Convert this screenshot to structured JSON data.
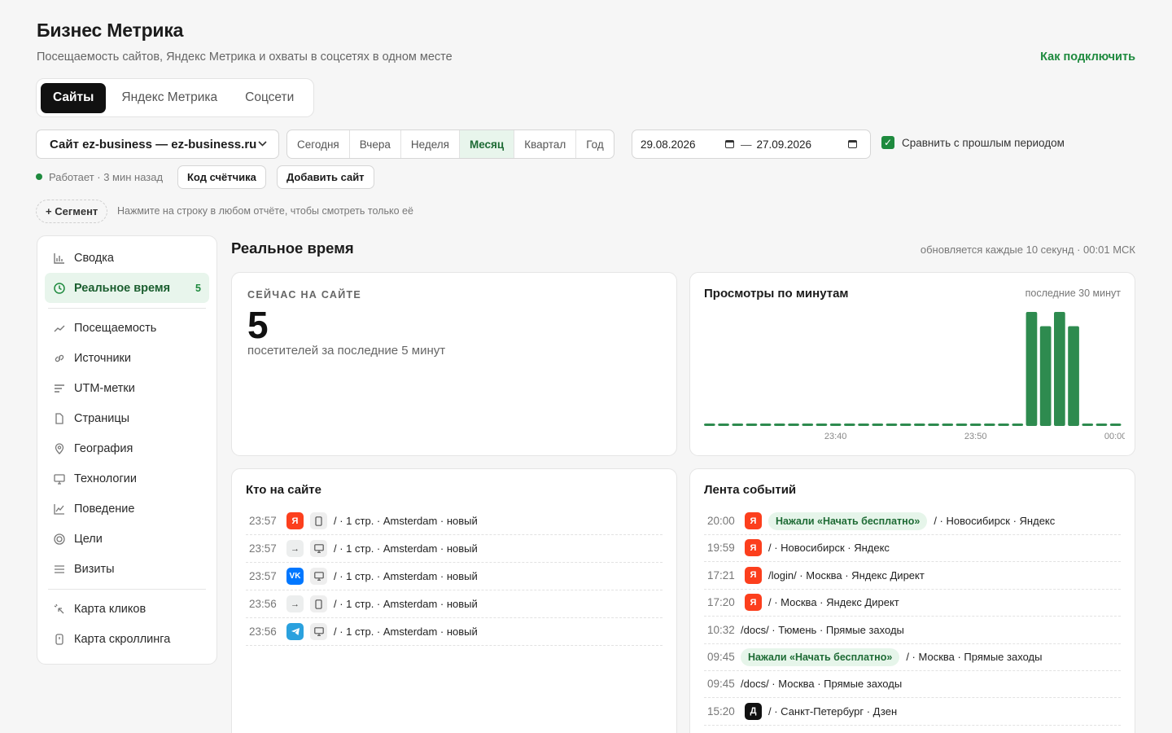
{
  "header": {
    "title": "Бизнес Метрика",
    "subtitle": "Посещаемость сайтов, Яндекс Метрика и охваты в соцсетях в одном месте",
    "howto_link": "Как подключить"
  },
  "tabs": [
    {
      "label": "Сайты",
      "active": true
    },
    {
      "label": "Яндекс Метрика",
      "active": false
    },
    {
      "label": "Соцсети",
      "active": false
    }
  ],
  "toolbar": {
    "site_select": "Сайт ez-business — ez-business.ru",
    "periods": [
      "Сегодня",
      "Вчера",
      "Неделя",
      "Месяц",
      "Квартал",
      "Год"
    ],
    "active_period": "Месяц",
    "date_from": "29.08.2026",
    "date_sep": "—",
    "date_to": "27.09.2026",
    "compare_label": "Сравнить с прошлым периодом",
    "compare_checked": true
  },
  "status": {
    "text": "Работает · 3 мин назад",
    "counter_button": "Код счётчика",
    "add_site_button": "Добавить сайт"
  },
  "segment": {
    "button": "+ Сегмент",
    "hint": "Нажмите на строку в любом отчёте, чтобы смотреть только её"
  },
  "sidebar": {
    "group1": [
      {
        "label": "Сводка",
        "icon": "bar-chart-icon"
      },
      {
        "label": "Реальное время",
        "icon": "clock-icon",
        "badge": "5",
        "active": true
      }
    ],
    "group2": [
      {
        "label": "Посещаемость",
        "icon": "trend-icon"
      },
      {
        "label": "Источники",
        "icon": "link-icon"
      },
      {
        "label": "UTM-метки",
        "icon": "lines-icon"
      },
      {
        "label": "Страницы",
        "icon": "page-icon"
      },
      {
        "label": "География",
        "icon": "pin-icon"
      },
      {
        "label": "Технологии",
        "icon": "monitor-icon"
      },
      {
        "label": "Поведение",
        "icon": "line-chart-icon"
      },
      {
        "label": "Цели",
        "icon": "target-icon"
      },
      {
        "label": "Визиты",
        "icon": "list-icon"
      }
    ],
    "group3": [
      {
        "label": "Карта кликов",
        "icon": "click-icon"
      },
      {
        "label": "Карта скроллинга",
        "icon": "scroll-icon"
      }
    ]
  },
  "main": {
    "title": "Реальное время",
    "update_note": "обновляется каждые 10 секунд · 00:01 МСК",
    "now": {
      "label": "СЕЙЧАС НА САЙТЕ",
      "value": "5",
      "caption": "посетителей за последние 5 минут"
    },
    "chart_card": {
      "title": "Просмотры по минутам",
      "range": "последние 30 минут"
    },
    "who_title": "Кто на сайте",
    "feed_title": "Лента событий"
  },
  "chart_data": {
    "type": "bar",
    "categories": [
      "23:31",
      "23:32",
      "23:33",
      "23:34",
      "23:35",
      "23:36",
      "23:37",
      "23:38",
      "23:39",
      "23:40",
      "23:41",
      "23:42",
      "23:43",
      "23:44",
      "23:45",
      "23:46",
      "23:47",
      "23:48",
      "23:49",
      "23:50",
      "23:51",
      "23:52",
      "23:53",
      "23:54",
      "23:55",
      "23:56",
      "23:57",
      "23:58",
      "23:59",
      "00:00"
    ],
    "values": [
      0,
      0,
      0,
      0,
      0,
      0,
      0,
      0,
      0,
      0,
      0,
      0,
      0,
      0,
      0,
      0,
      0,
      0,
      0,
      0,
      0,
      0,
      0,
      8,
      7,
      8,
      7,
      0,
      0,
      0
    ],
    "tick_labels": [
      "23:40",
      "23:50",
      "00:00"
    ],
    "title": "Просмотры по минутам",
    "xlabel": "",
    "ylabel": "",
    "color": "#2e8b4f",
    "grid": false
  },
  "visitors": [
    {
      "time": "23:57",
      "source": "ya",
      "source_label": "Я",
      "device": "phone-icon",
      "text": "/ · 1 стр. · Amsterdam · новый"
    },
    {
      "time": "23:57",
      "source": "direct",
      "source_label": "→",
      "device": "desktop-icon",
      "text": "/ · 1 стр. · Amsterdam · новый"
    },
    {
      "time": "23:57",
      "source": "vk",
      "source_label": "VK",
      "device": "desktop-icon",
      "text": "/ · 1 стр. · Amsterdam · новый"
    },
    {
      "time": "23:56",
      "source": "direct",
      "source_label": "→",
      "device": "phone-icon",
      "text": "/ · 1 стр. · Amsterdam · новый"
    },
    {
      "time": "23:56",
      "source": "tg",
      "source_label": "",
      "device": "desktop-icon",
      "text": "/ · 1 стр. · Amsterdam · новый"
    }
  ],
  "events": [
    {
      "time": "20:00",
      "source": "ya",
      "source_label": "Я",
      "pill": "Нажали «Начать бесплатно»",
      "text": "/ · Новосибирск · Яндекс"
    },
    {
      "time": "19:59",
      "source": "ya",
      "source_label": "Я",
      "pill": "",
      "text": "/ · Новосибирск · Яндекс"
    },
    {
      "time": "17:21",
      "source": "ya",
      "source_label": "Я",
      "pill": "",
      "text": "/login/ · Москва · Яндекс Директ"
    },
    {
      "time": "17:20",
      "source": "ya",
      "source_label": "Я",
      "pill": "",
      "text": "/ · Москва · Яндекс Директ"
    },
    {
      "time": "10:32",
      "source": "",
      "source_label": "",
      "pill": "",
      "text": "/docs/ · Тюмень · Прямые заходы"
    },
    {
      "time": "09:45",
      "source": "",
      "source_label": "",
      "pill": "Нажали «Начать бесплатно»",
      "text": "/ · Москва · Прямые заходы"
    },
    {
      "time": "09:45",
      "source": "",
      "source_label": "",
      "pill": "",
      "text": "/docs/ · Москва · Прямые заходы"
    },
    {
      "time": "15:20",
      "source": "dzen",
      "source_label": "Д",
      "pill": "",
      "text": "/ · Санкт-Петербург · Дзен"
    }
  ]
}
